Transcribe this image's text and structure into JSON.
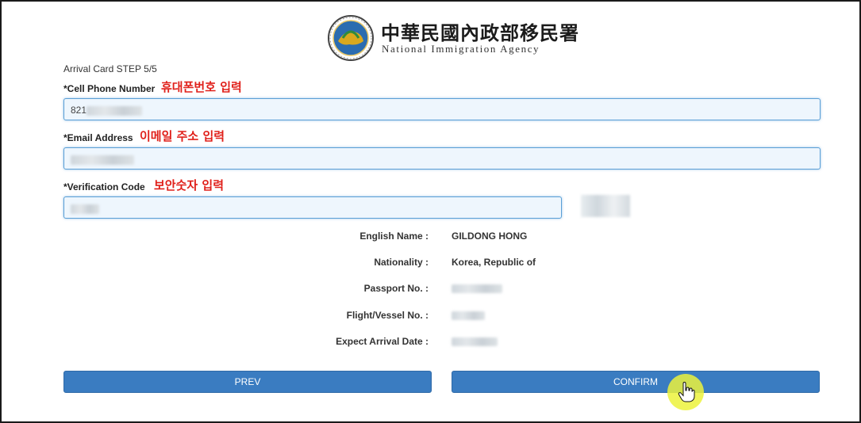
{
  "header": {
    "agency_name_cn": "中華民國內政部移民署",
    "agency_name_en": "National Immigration Agency",
    "logo_icon": "national-immigration-agency-seal"
  },
  "step_label": "Arrival Card STEP 5/5",
  "fields": {
    "phone": {
      "label": "*Cell Phone Number",
      "annotation": "휴대폰번호 입력",
      "value_prefix": "821"
    },
    "email": {
      "label": "*Email Address",
      "annotation": "이메일 주소 입력"
    },
    "verification": {
      "label": "*Verification Code",
      "annotation": "보안숫자 입력"
    }
  },
  "summary": {
    "english_name": {
      "label": "English Name :",
      "value": "GILDONG HONG"
    },
    "nationality": {
      "label": "Nationality :",
      "value": "Korea, Republic of"
    },
    "passport": {
      "label": "Passport No. :"
    },
    "flight": {
      "label": "Flight/Vessel No. :"
    },
    "arrival_date": {
      "label": "Expect Arrival Date :"
    }
  },
  "buttons": {
    "prev": "PREV",
    "confirm": "CONFIRM"
  },
  "colors": {
    "button": "#3a7cc1",
    "annotation": "#e0201a",
    "input_border": "#5a9fd6",
    "cursor_highlight": "#ecf23c"
  }
}
